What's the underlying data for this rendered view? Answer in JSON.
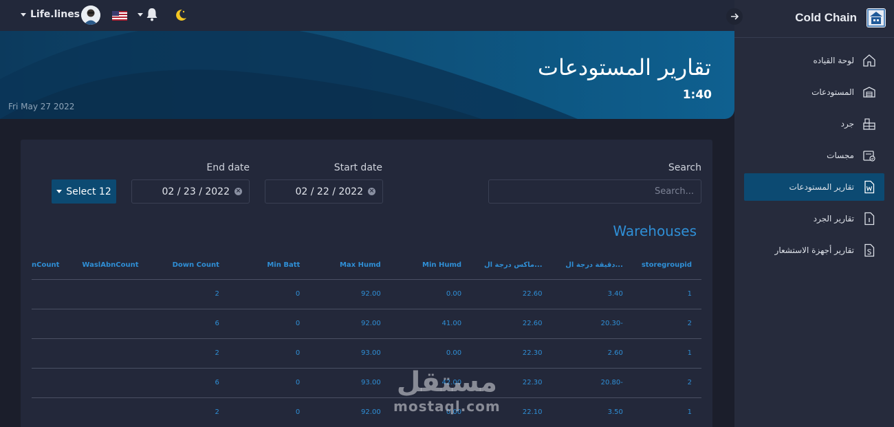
{
  "topbar": {
    "user_name": "Life.lines",
    "icons": [
      "avatar",
      "us-flag-icon",
      "bell-icon",
      "moon-icon"
    ]
  },
  "sidebar": {
    "brand": "Cold Chain",
    "items": [
      {
        "label": "لوحة القياده",
        "icon": "home-icon",
        "active": false
      },
      {
        "label": "المستودعات",
        "icon": "warehouse-icon",
        "active": false
      },
      {
        "label": "جرد",
        "icon": "inventory-icon",
        "active": false
      },
      {
        "label": "مجسات",
        "icon": "sensor-icon",
        "active": false
      },
      {
        "label": "تقارير المستودعات",
        "icon": "word-doc-icon",
        "active": true
      },
      {
        "label": "تقارير الجرد",
        "icon": "doc-i-icon",
        "active": false
      },
      {
        "label": "تقارير أجهزة الاستشعار",
        "icon": "doc-s-icon",
        "active": false
      }
    ]
  },
  "hero": {
    "title": "تقارير المستودعات",
    "time": "1:40",
    "date": "Fri May 27 2022"
  },
  "filters": {
    "search_label": "Search",
    "search_placeholder": "Search...",
    "start_label": "Start date",
    "start_value": "02 / 22 / 2022",
    "end_label": "End date",
    "end_value": "02 / 23 / 2022",
    "select_label": "Select 12"
  },
  "table": {
    "title": "Warehouses",
    "columns": [
      "nCount",
      "WaslAbnCount",
      "Down Count",
      "Min Batt",
      "Max Humd",
      "Min Humd",
      "ماكس درجة ال...",
      "دقيقة درجة ال...",
      "storegroupid"
    ],
    "rows": [
      [
        "",
        "",
        "2",
        "0",
        "92.00",
        "0.00",
        "22.60",
        "3.40",
        "1"
      ],
      [
        "",
        "",
        "6",
        "0",
        "92.00",
        "41.00",
        "22.60",
        "20.30-",
        "2"
      ],
      [
        "",
        "",
        "2",
        "0",
        "93.00",
        "0.00",
        "22.30",
        "2.60",
        "1"
      ],
      [
        "",
        "",
        "6",
        "0",
        "93.00",
        "42.00",
        "22.30",
        "20.80-",
        "2"
      ],
      [
        "",
        "",
        "2",
        "0",
        "92.00",
        "0.00",
        "22.10",
        "3.50",
        "1"
      ]
    ]
  },
  "watermark": {
    "arabic": "مستقل",
    "latin": "mostaql.com"
  },
  "colors": {
    "accent": "#2f8fd6",
    "active_nav": "#0c4a72",
    "sidebar_bg": "#262b3c",
    "card_bg": "#23283a"
  }
}
